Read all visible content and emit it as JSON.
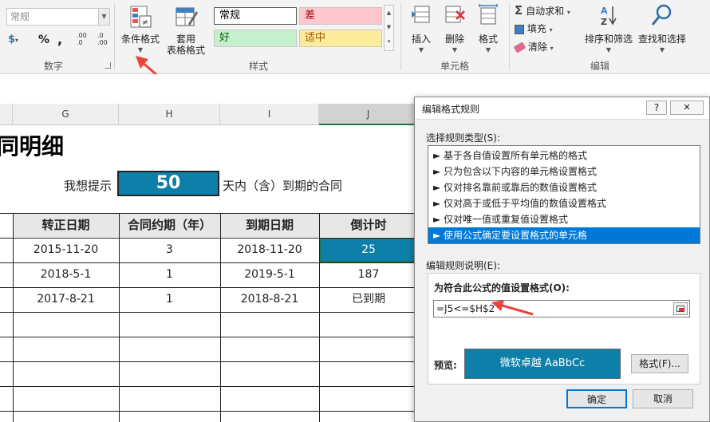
{
  "ribbon": {
    "font_box": "常规",
    "number": {
      "percent": "%",
      "comma": ",",
      "inc_decimal": ".00 .0",
      "dec_decimal": ".0 .00",
      "group_label": "数字"
    },
    "cond_format": "条件格式",
    "table_format": "套用\n表格格式",
    "styles": {
      "normal": "常规",
      "bad": "差",
      "good": "好",
      "neutral": "适中",
      "group_label": "样式"
    },
    "cells": {
      "insert": "插入",
      "delete": "删除",
      "format": "格式",
      "group_label": "单元格"
    },
    "editing": {
      "autosum": "自动求和",
      "fill": "填充",
      "clear": "清除",
      "sort": "排序和筛选",
      "find": "查找和选择",
      "group_label": "编辑"
    }
  },
  "sheet": {
    "columns": [
      "G",
      "H",
      "I",
      "J"
    ],
    "title": "同明细",
    "prompt_prefix": "我想提示",
    "prompt_value": "50",
    "prompt_suffix": "天内（含）到期的合同",
    "headers": [
      "转正日期",
      "合同约期（年）",
      "到期日期",
      "倒计时"
    ],
    "rows": [
      [
        "2015-11-20",
        "3",
        "2018-11-20",
        "25"
      ],
      [
        "2018-5-1",
        "1",
        "2019-5-1",
        "187"
      ],
      [
        "2017-8-21",
        "1",
        "2018-8-21",
        "已到期"
      ]
    ]
  },
  "dialog": {
    "title": "编辑格式规则",
    "help": "?",
    "close": "✕",
    "select_type_label": "选择规则类型(S):",
    "rule_types": [
      "► 基于各自值设置所有单元格的格式",
      "► 只为包含以下内容的单元格设置格式",
      "► 仅对排名靠前或靠后的数值设置格式",
      "► 仅对高于或低于平均值的数值设置格式",
      "► 仅对唯一值或重复值设置格式",
      "► 使用公式确定要设置格式的单元格"
    ],
    "selected_index": 5,
    "edit_desc_label": "编辑规则说明(E):",
    "formula_label": "为符合此公式的值设置格式(O):",
    "formula": "=J5<=$H$2",
    "preview_label": "预览:",
    "preview_text": "微软卓越  AaBbCc",
    "format_button": "格式(F)...",
    "ok": "确定",
    "cancel": "取消"
  },
  "colors": {
    "accent": "#0e7fa8",
    "selection": "#0078d7",
    "arrow": "#e8453c"
  }
}
